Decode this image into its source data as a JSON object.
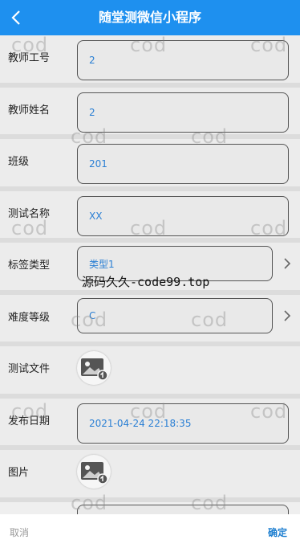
{
  "header": {
    "title": "随堂测微信小程序",
    "background": "#1e90ef"
  },
  "form": {
    "teacher_id": {
      "label": "教师工号",
      "value": "2"
    },
    "teacher_name": {
      "label": "教师姓名",
      "value": "2"
    },
    "class": {
      "label": "班级",
      "value": "201"
    },
    "test_name": {
      "label": "测试名称",
      "value": "XX"
    },
    "tag_type": {
      "label": "标签类型",
      "value": "类型1"
    },
    "difficulty": {
      "label": "难度等级",
      "value": "C"
    },
    "test_file": {
      "label": "测试文件",
      "icon": "image-upload-icon"
    },
    "publish_date": {
      "label": "发布日期",
      "value": "2021-04-24 22:18:35"
    },
    "image": {
      "label": "图片",
      "icon": "image-upload-icon"
    }
  },
  "footer": {
    "cancel_label": "取消",
    "confirm_label": "确定"
  },
  "watermarks": {
    "repeat_text": "cod",
    "center_text": "源码久久-code99.top"
  },
  "colors": {
    "accent": "#1e90ef",
    "value_text": "#2a7fd4",
    "confirm_text": "#1e7fd0"
  }
}
